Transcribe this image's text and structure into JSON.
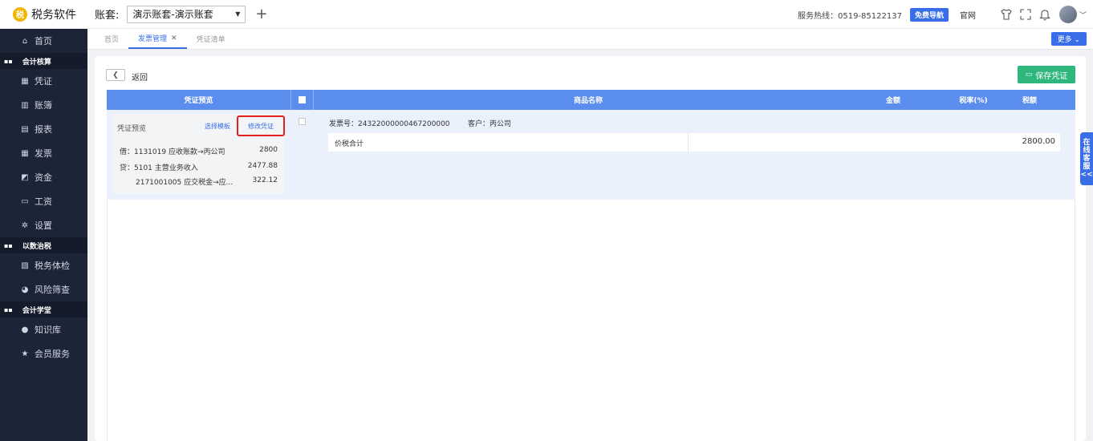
{
  "app": {
    "name": "税务软件",
    "logo_char": "税"
  },
  "header": {
    "account_label": "账套:",
    "account_value": "演示账套-演示账套",
    "hotline": "服务热线：0519-85122137",
    "guide_button": "免费导航",
    "official_site": "官网"
  },
  "sidebar": {
    "home": "首页",
    "groups": [
      {
        "title": "会计核算",
        "items": [
          "凭证",
          "账簿",
          "报表",
          "发票",
          "资金",
          "工资",
          "设置"
        ]
      },
      {
        "title": "以数治税",
        "items": [
          "税务体检",
          "风险筛查"
        ]
      },
      {
        "title": "会计学堂",
        "items": [
          "知识库",
          "会员服务"
        ]
      }
    ]
  },
  "tabs": [
    {
      "label": "首页",
      "active": false
    },
    {
      "label": "发票管理",
      "active": true,
      "closable": true
    },
    {
      "label": "凭证清单",
      "active": false
    }
  ],
  "more_button": "更多",
  "toolbar": {
    "back_label": "返回",
    "save_label": "保存凭证"
  },
  "table": {
    "headers": {
      "preview": "凭证预览",
      "name": "商品名称",
      "amount": "金额",
      "rate": "税率(%)",
      "tax": "税额"
    },
    "row": {
      "card": {
        "title": "凭证预览",
        "select_template": "选择模板",
        "edit_voucher": "修改凭证",
        "entries": [
          {
            "text": "借：1131019 应收账款→丙公司",
            "amount": "2800"
          },
          {
            "text": "贷：5101 主营业务收入",
            "amount": "2477.88"
          },
          {
            "text": "2171001005 应交税金→应...",
            "amount": "322.12"
          }
        ]
      },
      "invoice_no": "发票号：24322000000467200000",
      "customer": "客户：丙公司",
      "total_label": "价税合计",
      "total_value": "2800.00"
    }
  },
  "service_tab": {
    "chars": [
      "在",
      "线",
      "客",
      "服",
      "<<"
    ]
  },
  "colors": {
    "accent": "#3a6ee8",
    "save": "#2eb67d",
    "sidebar": "#1c2438",
    "highlight": "#e02020"
  }
}
